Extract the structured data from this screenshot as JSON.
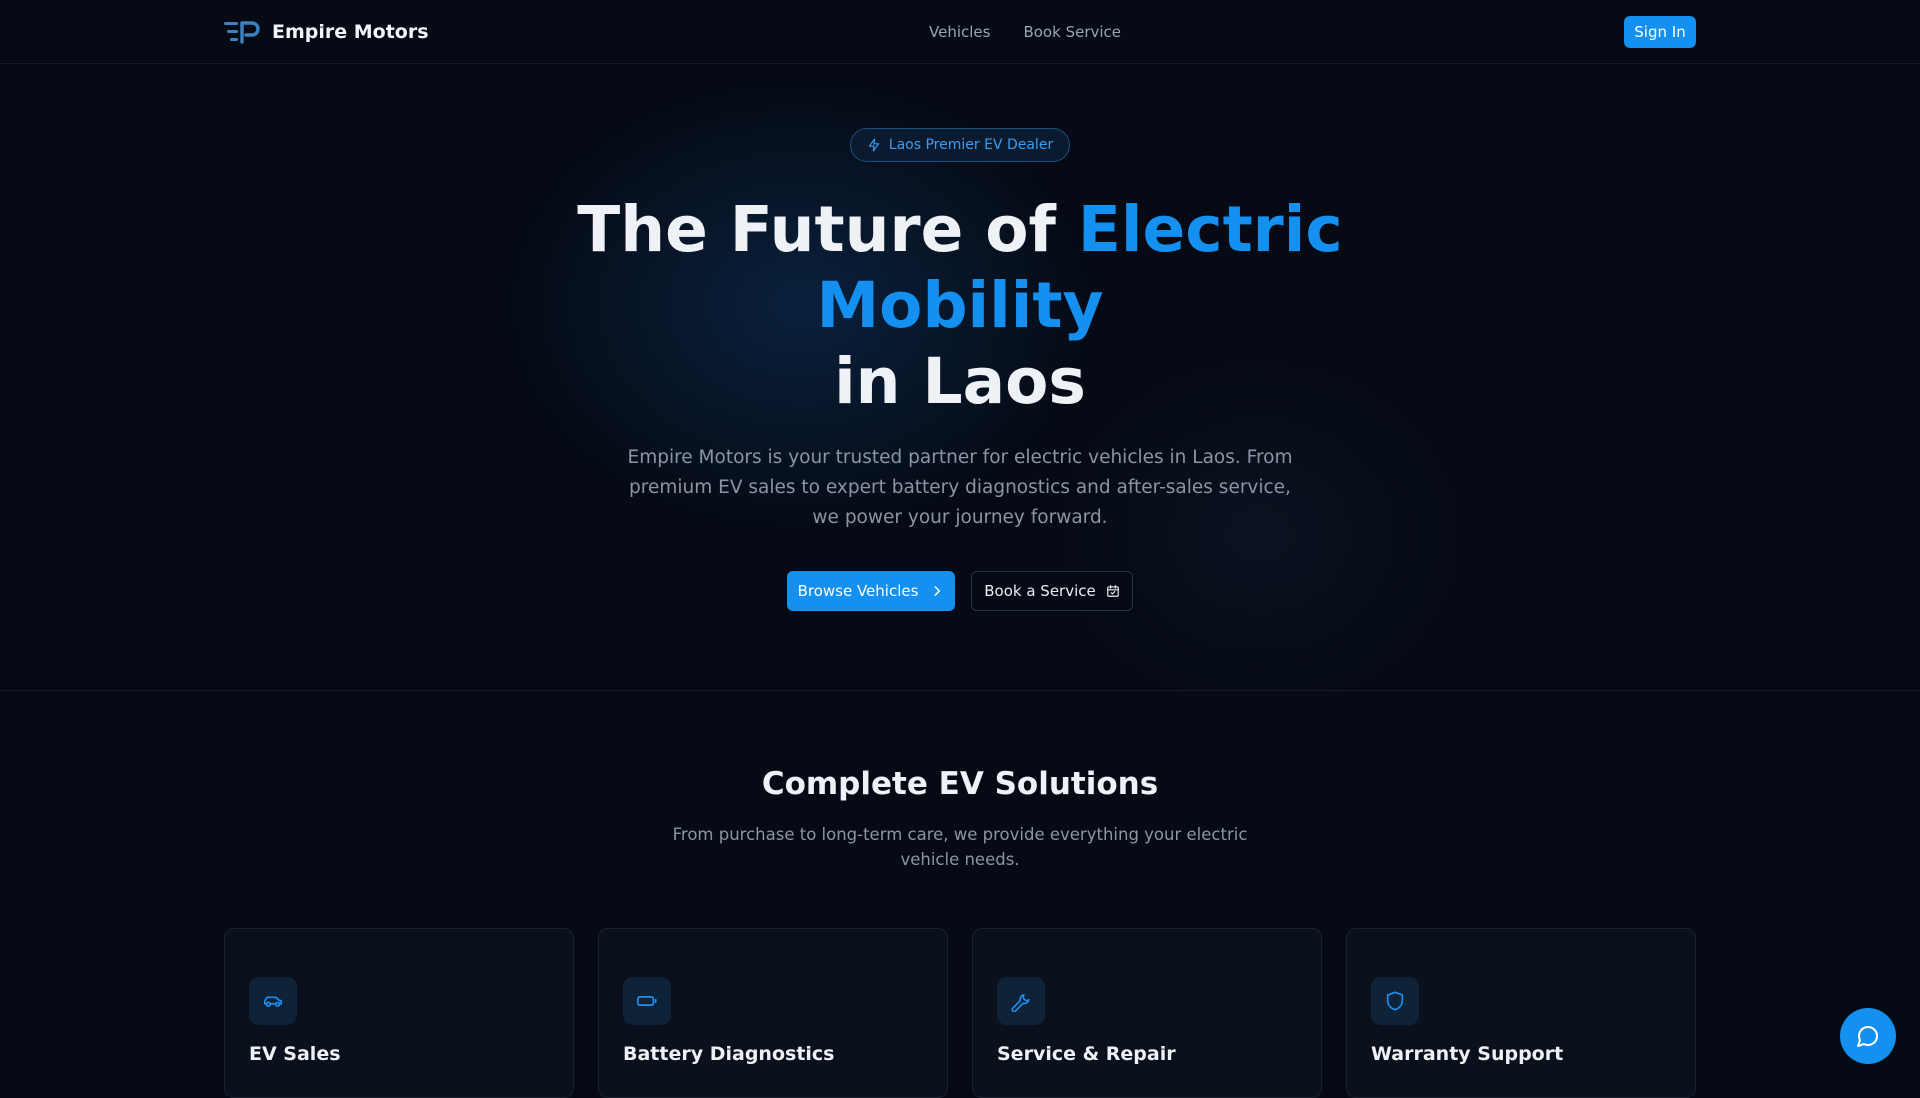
{
  "colors": {
    "accent": "#1390f0",
    "background": "#050a14",
    "muted_text": "#8b95a4"
  },
  "brand": {
    "name": "Empire Motors",
    "logo_icon": "ep-logo-icon"
  },
  "nav": {
    "links": [
      "Vehicles",
      "Book Service"
    ],
    "signin_label": "Sign In"
  },
  "hero": {
    "badge": "Laos Premier EV Dealer",
    "headline_prefix": "The Future of ",
    "headline_accent": "Electric Mobility",
    "headline_suffix": "in Laos",
    "description": "Empire Motors is your trusted partner for electric vehicles in Laos. From premium EV sales to expert battery diagnostics and after-sales service, we power your journey forward.",
    "primary_button": "Browse Vehicles",
    "secondary_button": "Book a Service"
  },
  "solutions": {
    "title": "Complete EV Solutions",
    "description": "From purchase to long-term care, we provide everything your electric vehicle needs.",
    "cards": [
      {
        "title": "EV Sales",
        "icon": "car-icon"
      },
      {
        "title": "Battery Diagnostics",
        "icon": "battery-icon"
      },
      {
        "title": "Service & Repair",
        "icon": "wrench-icon"
      },
      {
        "title": "Warranty Support",
        "icon": "shield-icon"
      }
    ]
  },
  "chat": {
    "icon": "chat-bubble-icon"
  }
}
